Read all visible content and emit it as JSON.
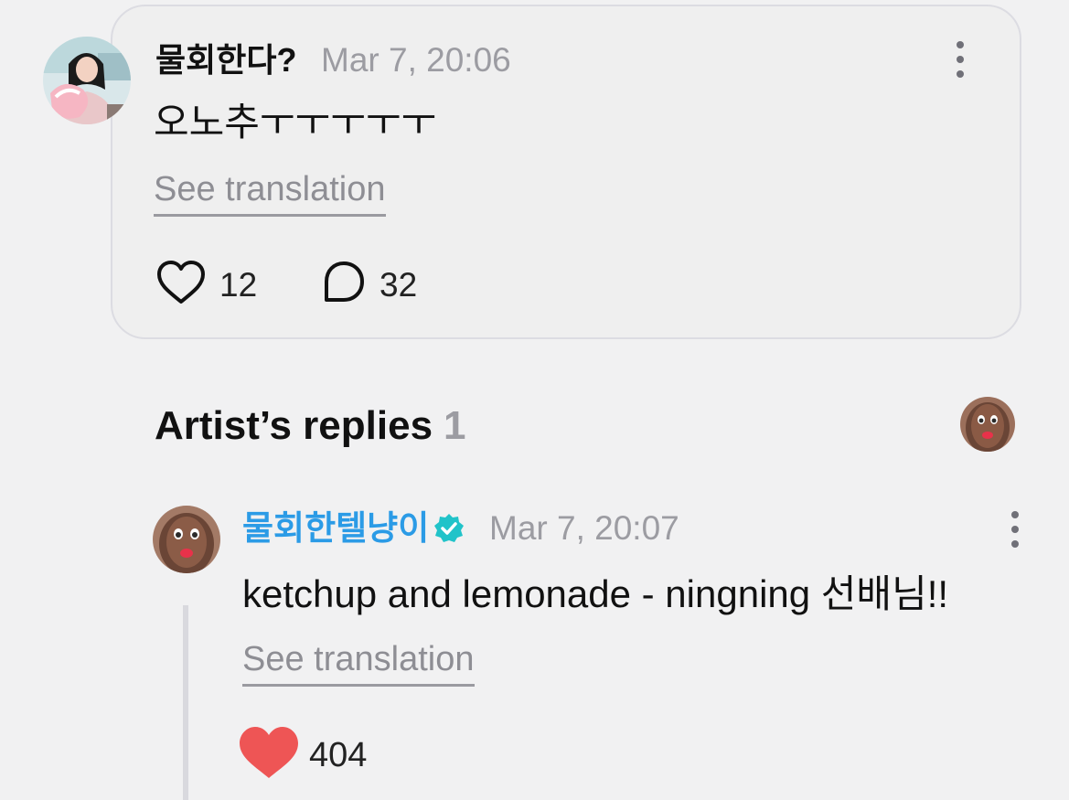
{
  "post": {
    "author": "물회한다?",
    "timestamp": "Mar 7, 20:06",
    "text": "오노추ㅜㅜㅜㅜㅜ",
    "see_translation": "See translation",
    "likes": "12",
    "comments": "32",
    "icons": {
      "like": "heart-outline-icon",
      "comment": "speech-bubble-icon",
      "menu": "more-vertical-icon"
    }
  },
  "artist_replies": {
    "title": "Artist’s replies",
    "count": "1"
  },
  "reply": {
    "author": "물회한텔냥이",
    "verified": true,
    "timestamp": "Mar 7, 20:07",
    "text": "ketchup and lemonade - ningning 선배님!!",
    "see_translation": "See translation",
    "likes": "404",
    "icons": {
      "like": "heart-filled-icon",
      "verified": "verified-badge-icon",
      "menu": "more-vertical-icon"
    }
  },
  "colors": {
    "background": "#f1f1f2",
    "card_border": "#dcdce2",
    "artist_name": "#2b9be6",
    "verified_badge": "#21c3c9",
    "liked_heart": "#ee5555",
    "muted_text": "#9c9ca2"
  }
}
